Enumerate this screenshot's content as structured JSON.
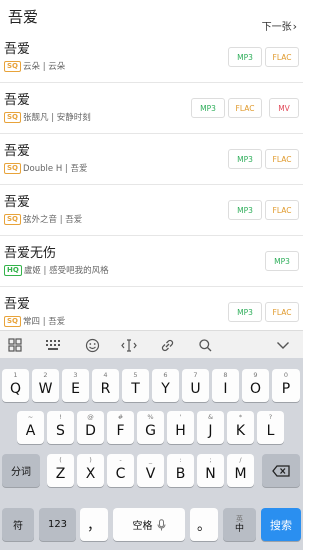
{
  "header": {
    "query": "吾爱",
    "next_page": "下一张"
  },
  "results": [
    {
      "title": "吾爱",
      "quality": "SQ",
      "meta": "云朵 | 云朵",
      "formats": [
        "MP3",
        "FLAC"
      ]
    },
    {
      "title": "吾爱",
      "quality": "SQ",
      "meta": "张靓凡 | 安静时刻",
      "formats": [
        "MP3",
        "FLAC",
        "MV"
      ]
    },
    {
      "title": "吾爱",
      "quality": "SQ",
      "meta": "Double H | 吾爱",
      "formats": [
        "MP3",
        "FLAC"
      ]
    },
    {
      "title": "吾爱",
      "quality": "SQ",
      "meta": "弦外之音 | 吾爱",
      "formats": [
        "MP3",
        "FLAC"
      ]
    },
    {
      "title": "吾爱无伤",
      "quality": "HQ",
      "meta": "盧姬 | 感受吧我的风格",
      "formats": [
        "MP3"
      ]
    },
    {
      "title": "吾爱",
      "quality": "SQ",
      "meta": "常四 | 吾爱",
      "formats": [
        "MP3",
        "FLAC"
      ]
    }
  ],
  "toolbar_icons": [
    "grid-icon",
    "keypad-icon",
    "emoji-icon",
    "text-cursor-icon",
    "link-icon",
    "search-icon",
    "collapse-icon"
  ],
  "keyboard": {
    "row1": [
      {
        "ltr": "Q",
        "sym": "1"
      },
      {
        "ltr": "W",
        "sym": "2"
      },
      {
        "ltr": "E",
        "sym": "3"
      },
      {
        "ltr": "R",
        "sym": "4"
      },
      {
        "ltr": "T",
        "sym": "5"
      },
      {
        "ltr": "Y",
        "sym": "6"
      },
      {
        "ltr": "U",
        "sym": "7"
      },
      {
        "ltr": "I",
        "sym": "8"
      },
      {
        "ltr": "O",
        "sym": "9"
      },
      {
        "ltr": "P",
        "sym": "0"
      }
    ],
    "row2": [
      {
        "ltr": "A",
        "sym": "~"
      },
      {
        "ltr": "S",
        "sym": "!"
      },
      {
        "ltr": "D",
        "sym": "@"
      },
      {
        "ltr": "F",
        "sym": "#"
      },
      {
        "ltr": "G",
        "sym": "%"
      },
      {
        "ltr": "H",
        "sym": "'"
      },
      {
        "ltr": "J",
        "sym": "&"
      },
      {
        "ltr": "K",
        "sym": "*"
      },
      {
        "ltr": "L",
        "sym": "?"
      }
    ],
    "row3": [
      {
        "ltr": "Z",
        "sym": "("
      },
      {
        "ltr": "X",
        "sym": ")"
      },
      {
        "ltr": "C",
        "sym": "-"
      },
      {
        "ltr": "V",
        "sym": "_"
      },
      {
        "ltr": "B",
        "sym": ":"
      },
      {
        "ltr": "N",
        "sym": ";"
      },
      {
        "ltr": "M",
        "sym": "/"
      }
    ],
    "segment_label": "分词",
    "symbol_label": "符",
    "number_label": "123",
    "comma": "，",
    "space_label": "空格",
    "period": "。",
    "lang_top": "英",
    "lang_bottom": "中",
    "search_label": "搜索"
  }
}
